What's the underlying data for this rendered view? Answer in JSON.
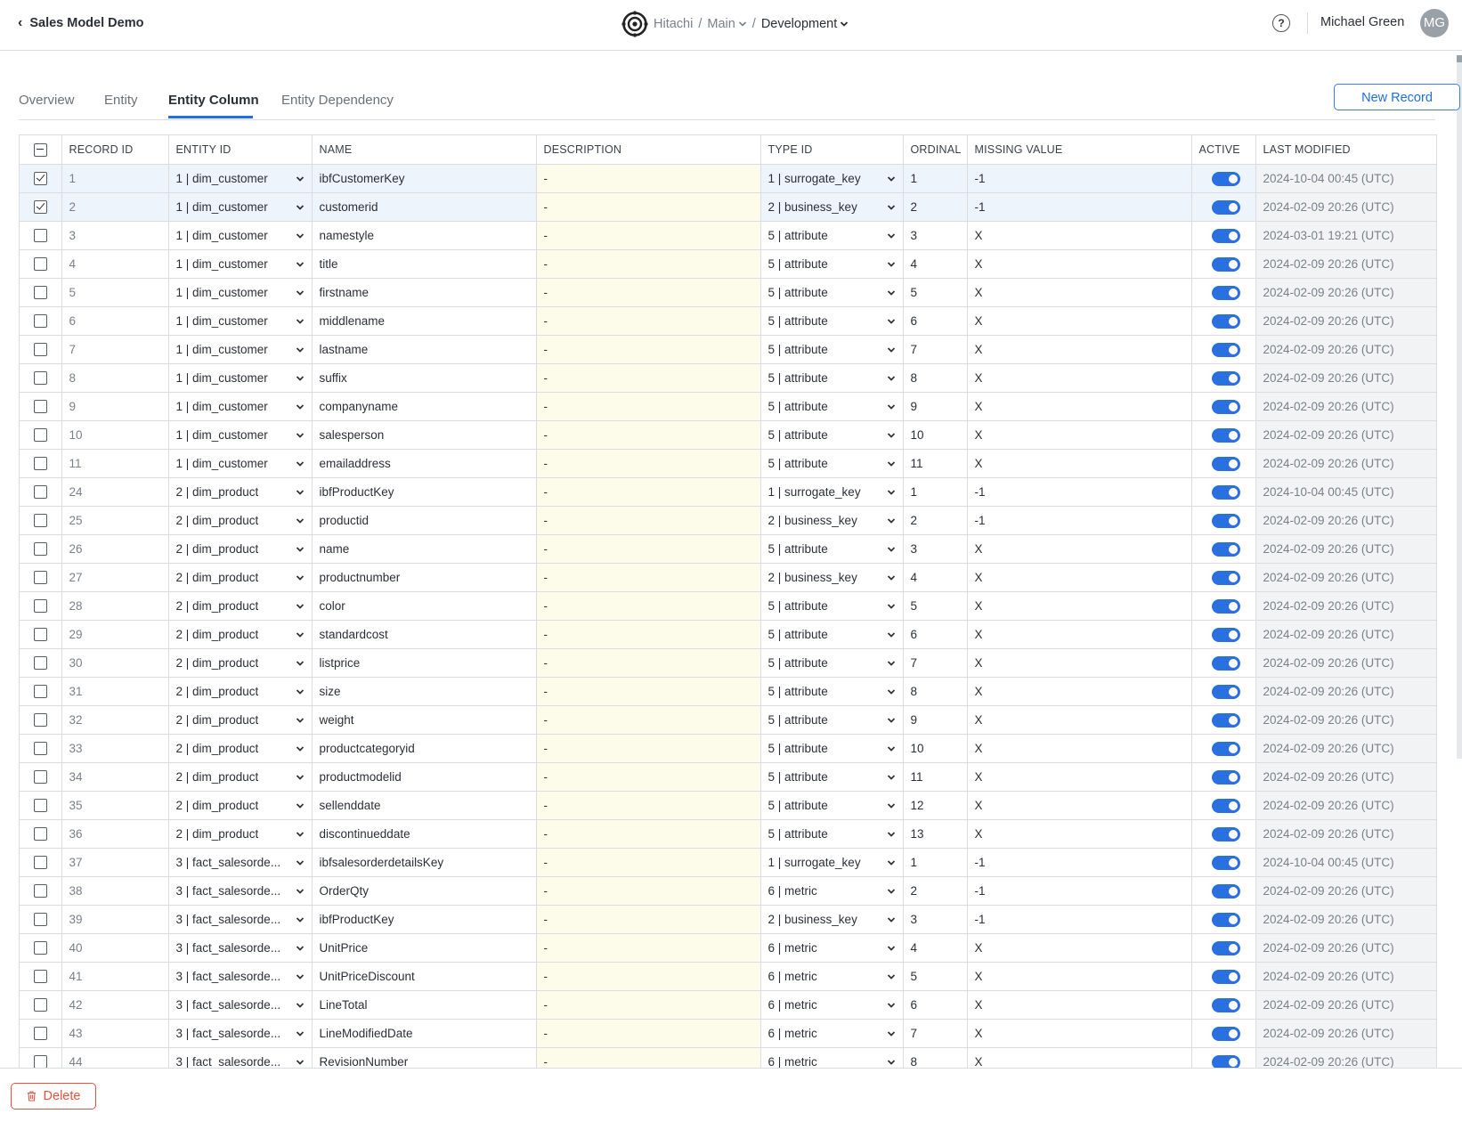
{
  "header": {
    "back_label": "Sales Model Demo",
    "org": "Hitachi",
    "branch": "Main",
    "environment": "Development",
    "separator": "/",
    "help_label": "?",
    "user_name": "Michael Green",
    "user_initials": "MG"
  },
  "tabs": [
    {
      "label": "Overview",
      "active": false
    },
    {
      "label": "Entity",
      "active": false
    },
    {
      "label": "Entity Column",
      "active": true
    },
    {
      "label": "Entity Dependency",
      "active": false
    }
  ],
  "actions": {
    "new_record_label": "New Record",
    "delete_label": "Delete"
  },
  "colors": {
    "accent": "#1f6fde",
    "danger": "#e5533f",
    "selected_row": "#eef4fc",
    "description_bg": "#fdfcea"
  },
  "columns": [
    "RECORD ID",
    "ENTITY ID",
    "NAME",
    "DESCRIPTION",
    "TYPE ID",
    "ORDINAL",
    "MISSING VALUE",
    "ACTIVE",
    "LAST MODIFIED"
  ],
  "rows": [
    {
      "selected": true,
      "record_id": "1",
      "entity_id": "1 | dim_customer",
      "name": "ibfCustomerKey",
      "description": "-",
      "type_id": "1 | surrogate_key",
      "ordinal": "1",
      "missing_value": "-1",
      "active": true,
      "last_modified": "2024-10-04 00:45 (UTC)"
    },
    {
      "selected": true,
      "record_id": "2",
      "entity_id": "1 | dim_customer",
      "name": "customerid",
      "description": "-",
      "type_id": "2 | business_key",
      "ordinal": "2",
      "missing_value": "-1",
      "active": true,
      "last_modified": "2024-02-09 20:26 (UTC)"
    },
    {
      "selected": false,
      "record_id": "3",
      "entity_id": "1 | dim_customer",
      "name": "namestyle",
      "description": "-",
      "type_id": "5 | attribute",
      "ordinal": "3",
      "missing_value": "X",
      "active": true,
      "last_modified": "2024-03-01 19:21 (UTC)"
    },
    {
      "selected": false,
      "record_id": "4",
      "entity_id": "1 | dim_customer",
      "name": "title",
      "description": "-",
      "type_id": "5 | attribute",
      "ordinal": "4",
      "missing_value": "X",
      "active": true,
      "last_modified": "2024-02-09 20:26 (UTC)"
    },
    {
      "selected": false,
      "record_id": "5",
      "entity_id": "1 | dim_customer",
      "name": "firstname",
      "description": "-",
      "type_id": "5 | attribute",
      "ordinal": "5",
      "missing_value": "X",
      "active": true,
      "last_modified": "2024-02-09 20:26 (UTC)"
    },
    {
      "selected": false,
      "record_id": "6",
      "entity_id": "1 | dim_customer",
      "name": "middlename",
      "description": "-",
      "type_id": "5 | attribute",
      "ordinal": "6",
      "missing_value": "X",
      "active": true,
      "last_modified": "2024-02-09 20:26 (UTC)"
    },
    {
      "selected": false,
      "record_id": "7",
      "entity_id": "1 | dim_customer",
      "name": "lastname",
      "description": "-",
      "type_id": "5 | attribute",
      "ordinal": "7",
      "missing_value": "X",
      "active": true,
      "last_modified": "2024-02-09 20:26 (UTC)"
    },
    {
      "selected": false,
      "record_id": "8",
      "entity_id": "1 | dim_customer",
      "name": "suffix",
      "description": "-",
      "type_id": "5 | attribute",
      "ordinal": "8",
      "missing_value": "X",
      "active": true,
      "last_modified": "2024-02-09 20:26 (UTC)"
    },
    {
      "selected": false,
      "record_id": "9",
      "entity_id": "1 | dim_customer",
      "name": "companyname",
      "description": "-",
      "type_id": "5 | attribute",
      "ordinal": "9",
      "missing_value": "X",
      "active": true,
      "last_modified": "2024-02-09 20:26 (UTC)"
    },
    {
      "selected": false,
      "record_id": "10",
      "entity_id": "1 | dim_customer",
      "name": "salesperson",
      "description": "-",
      "type_id": "5 | attribute",
      "ordinal": "10",
      "missing_value": "X",
      "active": true,
      "last_modified": "2024-02-09 20:26 (UTC)"
    },
    {
      "selected": false,
      "record_id": "11",
      "entity_id": "1 | dim_customer",
      "name": "emailaddress",
      "description": "-",
      "type_id": "5 | attribute",
      "ordinal": "11",
      "missing_value": "X",
      "active": true,
      "last_modified": "2024-02-09 20:26 (UTC)"
    },
    {
      "selected": false,
      "record_id": "24",
      "entity_id": "2 | dim_product",
      "name": "ibfProductKey",
      "description": "-",
      "type_id": "1 | surrogate_key",
      "ordinal": "1",
      "missing_value": "-1",
      "active": true,
      "last_modified": "2024-10-04 00:45 (UTC)"
    },
    {
      "selected": false,
      "record_id": "25",
      "entity_id": "2 | dim_product",
      "name": "productid",
      "description": "-",
      "type_id": "2 | business_key",
      "ordinal": "2",
      "missing_value": "-1",
      "active": true,
      "last_modified": "2024-02-09 20:26 (UTC)"
    },
    {
      "selected": false,
      "record_id": "26",
      "entity_id": "2 | dim_product",
      "name": "name",
      "description": "-",
      "type_id": "5 | attribute",
      "ordinal": "3",
      "missing_value": "X",
      "active": true,
      "last_modified": "2024-02-09 20:26 (UTC)"
    },
    {
      "selected": false,
      "record_id": "27",
      "entity_id": "2 | dim_product",
      "name": "productnumber",
      "description": "-",
      "type_id": "2 | business_key",
      "ordinal": "4",
      "missing_value": "X",
      "active": true,
      "last_modified": "2024-02-09 20:26 (UTC)"
    },
    {
      "selected": false,
      "record_id": "28",
      "entity_id": "2 | dim_product",
      "name": "color",
      "description": "-",
      "type_id": "5 | attribute",
      "ordinal": "5",
      "missing_value": "X",
      "active": true,
      "last_modified": "2024-02-09 20:26 (UTC)"
    },
    {
      "selected": false,
      "record_id": "29",
      "entity_id": "2 | dim_product",
      "name": "standardcost",
      "description": "-",
      "type_id": "5 | attribute",
      "ordinal": "6",
      "missing_value": "X",
      "active": true,
      "last_modified": "2024-02-09 20:26 (UTC)"
    },
    {
      "selected": false,
      "record_id": "30",
      "entity_id": "2 | dim_product",
      "name": "listprice",
      "description": "-",
      "type_id": "5 | attribute",
      "ordinal": "7",
      "missing_value": "X",
      "active": true,
      "last_modified": "2024-02-09 20:26 (UTC)"
    },
    {
      "selected": false,
      "record_id": "31",
      "entity_id": "2 | dim_product",
      "name": "size",
      "description": "-",
      "type_id": "5 | attribute",
      "ordinal": "8",
      "missing_value": "X",
      "active": true,
      "last_modified": "2024-02-09 20:26 (UTC)"
    },
    {
      "selected": false,
      "record_id": "32",
      "entity_id": "2 | dim_product",
      "name": "weight",
      "description": "-",
      "type_id": "5 | attribute",
      "ordinal": "9",
      "missing_value": "X",
      "active": true,
      "last_modified": "2024-02-09 20:26 (UTC)"
    },
    {
      "selected": false,
      "record_id": "33",
      "entity_id": "2 | dim_product",
      "name": "productcategoryid",
      "description": "-",
      "type_id": "5 | attribute",
      "ordinal": "10",
      "missing_value": "X",
      "active": true,
      "last_modified": "2024-02-09 20:26 (UTC)"
    },
    {
      "selected": false,
      "record_id": "34",
      "entity_id": "2 | dim_product",
      "name": "productmodelid",
      "description": "-",
      "type_id": "5 | attribute",
      "ordinal": "11",
      "missing_value": "X",
      "active": true,
      "last_modified": "2024-02-09 20:26 (UTC)"
    },
    {
      "selected": false,
      "record_id": "35",
      "entity_id": "2 | dim_product",
      "name": "sellenddate",
      "description": "-",
      "type_id": "5 | attribute",
      "ordinal": "12",
      "missing_value": "X",
      "active": true,
      "last_modified": "2024-02-09 20:26 (UTC)"
    },
    {
      "selected": false,
      "record_id": "36",
      "entity_id": "2 | dim_product",
      "name": "discontinueddate",
      "description": "-",
      "type_id": "5 | attribute",
      "ordinal": "13",
      "missing_value": "X",
      "active": true,
      "last_modified": "2024-02-09 20:26 (UTC)"
    },
    {
      "selected": false,
      "record_id": "37",
      "entity_id": "3 | fact_salesorde...",
      "name": "ibfsalesorderdetailsKey",
      "description": "-",
      "type_id": "1 | surrogate_key",
      "ordinal": "1",
      "missing_value": "-1",
      "active": true,
      "last_modified": "2024-10-04 00:45 (UTC)"
    },
    {
      "selected": false,
      "record_id": "38",
      "entity_id": "3 | fact_salesorde...",
      "name": "OrderQty",
      "description": "-",
      "type_id": "6 | metric",
      "ordinal": "2",
      "missing_value": "-1",
      "active": true,
      "last_modified": "2024-02-09 20:26 (UTC)"
    },
    {
      "selected": false,
      "record_id": "39",
      "entity_id": "3 | fact_salesorde...",
      "name": "ibfProductKey",
      "description": "-",
      "type_id": "2 | business_key",
      "ordinal": "3",
      "missing_value": "-1",
      "active": true,
      "last_modified": "2024-02-09 20:26 (UTC)"
    },
    {
      "selected": false,
      "record_id": "40",
      "entity_id": "3 | fact_salesorde...",
      "name": "UnitPrice",
      "description": "-",
      "type_id": "6 | metric",
      "ordinal": "4",
      "missing_value": "X",
      "active": true,
      "last_modified": "2024-02-09 20:26 (UTC)"
    },
    {
      "selected": false,
      "record_id": "41",
      "entity_id": "3 | fact_salesorde...",
      "name": "UnitPriceDiscount",
      "description": "-",
      "type_id": "6 | metric",
      "ordinal": "5",
      "missing_value": "X",
      "active": true,
      "last_modified": "2024-02-09 20:26 (UTC)"
    },
    {
      "selected": false,
      "record_id": "42",
      "entity_id": "3 | fact_salesorde...",
      "name": "LineTotal",
      "description": "-",
      "type_id": "6 | metric",
      "ordinal": "6",
      "missing_value": "X",
      "active": true,
      "last_modified": "2024-02-09 20:26 (UTC)"
    },
    {
      "selected": false,
      "record_id": "43",
      "entity_id": "3 | fact_salesorde...",
      "name": "LineModifiedDate",
      "description": "-",
      "type_id": "6 | metric",
      "ordinal": "7",
      "missing_value": "X",
      "active": true,
      "last_modified": "2024-02-09 20:26 (UTC)"
    },
    {
      "selected": false,
      "record_id": "44",
      "entity_id": "3 | fact_salesorde...",
      "name": "RevisionNumber",
      "description": "-",
      "type_id": "6 | metric",
      "ordinal": "8",
      "missing_value": "X",
      "active": true,
      "last_modified": "2024-02-09 20:26 (UTC)"
    }
  ]
}
